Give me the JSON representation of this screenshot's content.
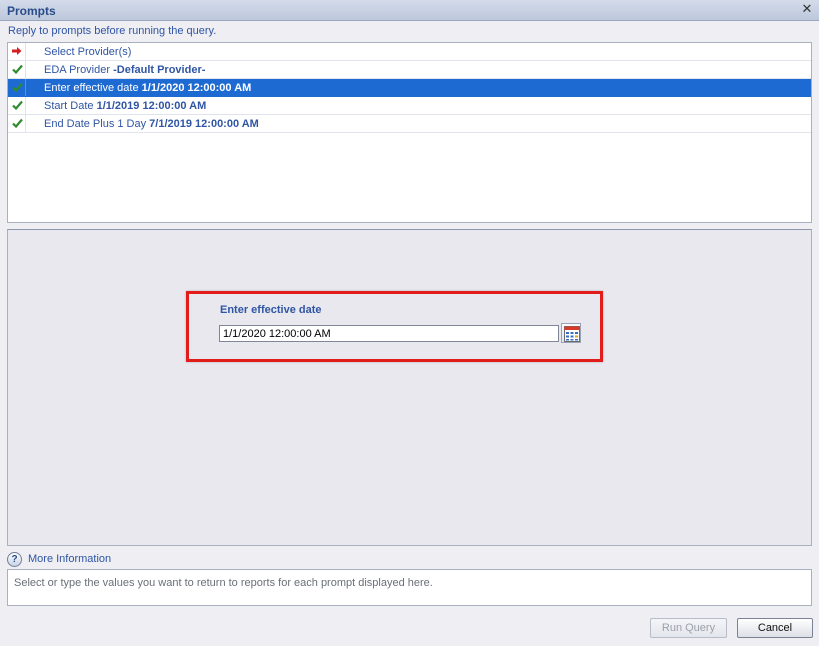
{
  "window": {
    "title": "Prompts",
    "close_icon": "close-icon"
  },
  "instruction": "Reply to prompts before running the query.",
  "prompts": [
    {
      "label": "Select Provider(s)",
      "value": "",
      "status": "arrow",
      "selected": false
    },
    {
      "label": "EDA Provider ",
      "value": "-Default Provider-",
      "status": "check",
      "selected": false
    },
    {
      "label": "Enter effective date ",
      "value": "1/1/2020 12:00:00 AM",
      "status": "check",
      "selected": true
    },
    {
      "label": "Start Date ",
      "value": "1/1/2019 12:00:00 AM",
      "status": "check",
      "selected": false
    },
    {
      "label": "End Date Plus 1 Day ",
      "value": "7/1/2019 12:00:00 AM",
      "status": "check",
      "selected": false
    }
  ],
  "editor": {
    "label": "Enter effective date",
    "value": "1/1/2020 12:00:00 AM",
    "calendar_icon": "calendar-icon"
  },
  "more_info": {
    "label": "More Information",
    "icon": "help-icon",
    "help_text": "Select or type the values you want to return to reports for each prompt displayed here."
  },
  "buttons": {
    "run_query": "Run Query",
    "cancel": "Cancel"
  },
  "colors": {
    "accent": "#1e6ad3",
    "link_text": "#2f55a4",
    "highlight_border": "#e21b1b",
    "check": "#2e8b2e",
    "arrow": "#d42020"
  }
}
